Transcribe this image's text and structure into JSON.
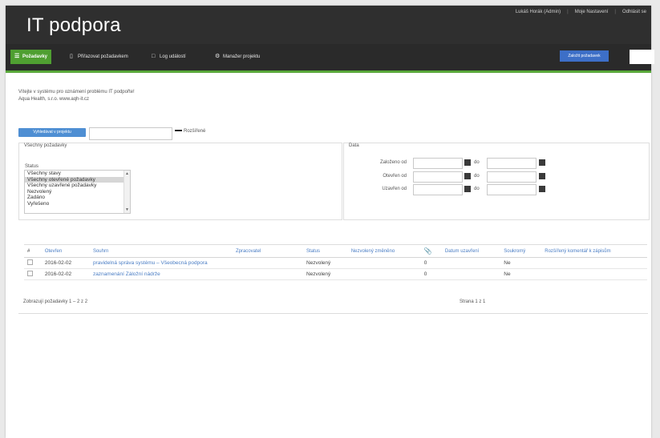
{
  "header": {
    "title": "IT podpora",
    "links": [
      "Lukáš Horák (Admin)",
      "Moje Nastavení",
      "Odhlásit se"
    ]
  },
  "nav": {
    "items": [
      {
        "label": "Požadavky",
        "icon": "list-icon",
        "active": true
      },
      {
        "label": "Přiřazovat požadavkem",
        "icon": "document-icon"
      },
      {
        "label": "Log událostí",
        "icon": "window-icon"
      },
      {
        "label": "Manažer projektu",
        "icon": "gear-icon"
      }
    ],
    "new_button": "Založit požadavek"
  },
  "welcome": {
    "line1": "Vítejte v systému pro oznámení problému IT podpořte!",
    "line2": "Aqua Health, s.r.o. www.aqh-it.cz"
  },
  "filter": {
    "project_button": "Vyhledávat v projektu",
    "expand": "Rozšířené",
    "all_title": "Všechny požadavky",
    "status_label": "Status",
    "status_options": [
      "Všechny stavy",
      "Všechny otevřené požadavky",
      "Všechny uzavřené požadavky",
      "Nezvolený",
      "Zadáno",
      "Vyřešeno"
    ],
    "date_title": "Data",
    "date_rows": [
      {
        "label": "Založeno od",
        "to": "do"
      },
      {
        "label": "Otevřen od",
        "to": "do"
      },
      {
        "label": "Uzavřen od",
        "to": "do"
      }
    ]
  },
  "table": {
    "headers": [
      "#",
      "Otevřen",
      "Souhrn",
      "Zpracovatel",
      "Status",
      "Nezvolený změněno",
      "",
      "Datum uzavření",
      "Soukromý",
      "Rozšířený komentář k zápisům"
    ],
    "rows": [
      {
        "date": "2016-02-02",
        "summary": "pravidelná správa systému – Všeobecná podpora",
        "status": "Nezvolený",
        "count": "0",
        "private": "Ne"
      },
      {
        "date": "2016-02-02",
        "summary": "zaznamenání Záložní nádrže",
        "status": "Nezvolený",
        "count": "0",
        "private": "Ne"
      }
    ]
  },
  "footer": {
    "left": "Zobrazují požadavky 1 – 2 z 2",
    "right": "Strana 1 z 1"
  },
  "colors": {
    "accent": "#4f9f31",
    "blue": "#3d6fc7",
    "header": "#2f2f2f"
  }
}
